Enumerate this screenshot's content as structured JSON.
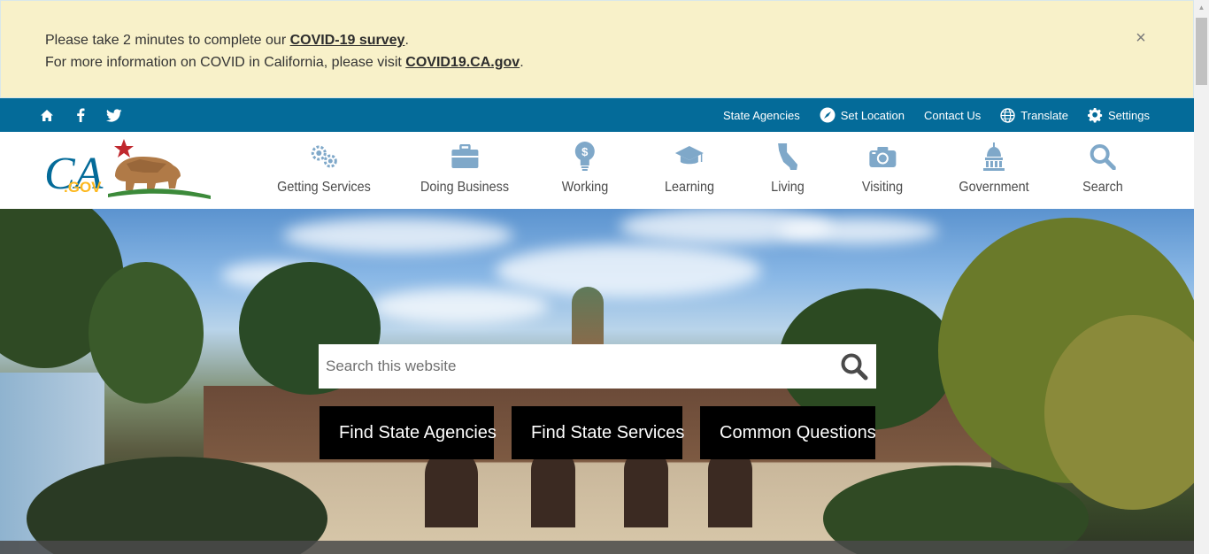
{
  "alert": {
    "line1_prefix": "Please take 2 minutes to complete our ",
    "line1_link": "COVID-19 survey",
    "line1_suffix": ".",
    "line2_prefix": "For more information on COVID in California, please visit ",
    "line2_link": "COVID19.CA.gov",
    "line2_suffix": ".",
    "close_glyph": "×"
  },
  "utility": {
    "left_icons": [
      "home-icon",
      "facebook-icon",
      "twitter-icon"
    ],
    "state_agencies": "State Agencies",
    "set_location": "Set Location",
    "contact_us": "Contact Us",
    "translate": "Translate",
    "settings": "Settings"
  },
  "logo": {
    "text_ca": "CA",
    "text_gov": ".GOV"
  },
  "nav": [
    {
      "label": "Getting Services",
      "icon": "gears-icon"
    },
    {
      "label": "Doing Business",
      "icon": "briefcase-icon"
    },
    {
      "label": "Working",
      "icon": "lightbulb-dollar-icon"
    },
    {
      "label": "Learning",
      "icon": "graduation-cap-icon"
    },
    {
      "label": "Living",
      "icon": "california-map-icon"
    },
    {
      "label": "Visiting",
      "icon": "camera-icon"
    },
    {
      "label": "Government",
      "icon": "capitol-icon"
    },
    {
      "label": "Search",
      "icon": "search-icon"
    }
  ],
  "hero": {
    "search_placeholder": "Search this website",
    "buttons": [
      {
        "label": "Find State Agencies",
        "icon": "hand-pointer-icon"
      },
      {
        "label": "Find State Services",
        "icon": "people-icon"
      },
      {
        "label": "Common Questions",
        "icon": "lightbulb-icon"
      }
    ]
  },
  "colors": {
    "alert_bg": "#f8f1c9",
    "utility_bg": "#046b99",
    "nav_icon": "#7fa8c9",
    "nav_text": "#4a4a4a"
  }
}
